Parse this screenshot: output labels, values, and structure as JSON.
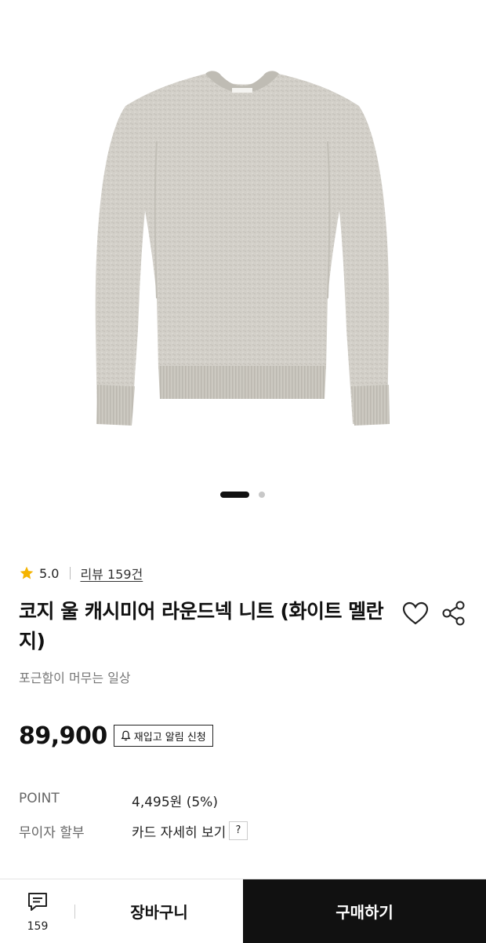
{
  "product": {
    "rating": "5.0",
    "review_label": "리뷰 159건",
    "title": "코지 울 캐시미어 라운드넥 니트 (화이트 멜란지)",
    "subtitle": "포근함이 머무는 일상",
    "price": "89,900",
    "restock_label": "재입고 알림 신청",
    "image_count": 2,
    "image_index": 1
  },
  "info": {
    "point_label": "POINT",
    "point_value": "4,495원 (5%)",
    "installment_label": "무이자 할부",
    "installment_value": "카드 자세히 보기",
    "help_label": "?"
  },
  "bottom_bar": {
    "chat_count": "159",
    "cart_label": "장바구니",
    "buy_label": "구매하기"
  },
  "icons": [
    "star-icon",
    "heart-icon",
    "share-icon",
    "bell-icon",
    "chat-icon"
  ],
  "colors": {
    "buy_button": "#111111",
    "star": "#f5b400",
    "sweater": "#cfccc4"
  }
}
